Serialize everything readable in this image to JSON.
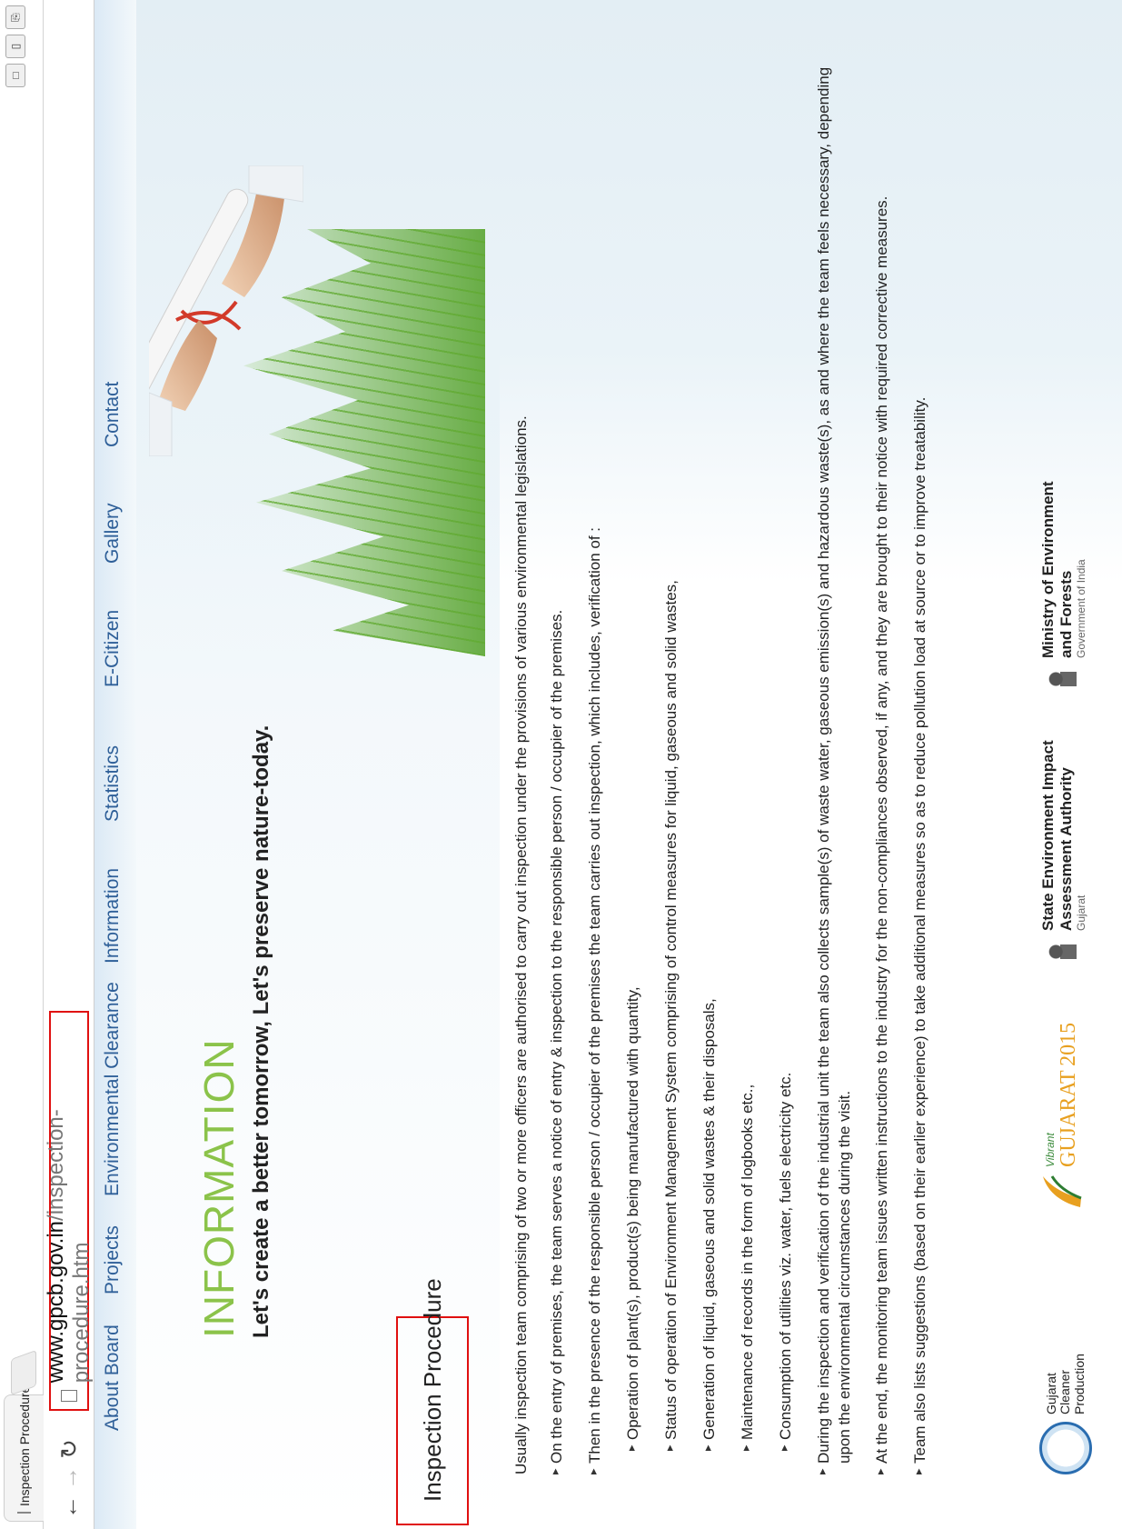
{
  "browser": {
    "tab_title": "Inspection Procedure",
    "tab_close": "×",
    "url_domain": "www.gpcb.gov.in",
    "url_path": "/inspection-procedure.htm",
    "window_controls": [
      "□",
      "▯",
      "⎘"
    ]
  },
  "nav": {
    "items": [
      "About Board",
      "Projects",
      "Environmental Clearance",
      "Information",
      "Statistics",
      "E-Citizen",
      "Gallery",
      "Contact"
    ]
  },
  "hero": {
    "heading": "INFORMATION",
    "tagline": "Let's create a better tomorrow, Let's preserve nature-today."
  },
  "section": {
    "title": "Inspection Procedure"
  },
  "content": {
    "intro": "Usually inspection team comprising of two or more officers are authorised to carry out inspection under the provisions of various environmental legislations.",
    "items": [
      "On the entry of premises, the team serves a notice of entry & inspection to the responsible person / occupier of the premises.",
      "Then in the presence of the responsible person / occupier of the premises the team carries out inspection, which includes, verification of :"
    ],
    "sub_items": [
      "Operation of plant(s), product(s) being manufactured with quantity,",
      "Status of operation of Environment Management System comprising of control measures for liquid, gaseous and solid wastes,",
      "Generation of liquid, gaseous and solid wastes & their disposals,",
      "Maintenance of records in the form of logbooks etc.,",
      "Consumption of utilities viz. water, fuels electricity etc."
    ],
    "items_after": [
      "During the inspection and verification of the industrial unit the team also collects sample(s) of waste water, gaseous emission(s) and hazardous waste(s), as and where the team feels necessary, depending upon the environmental circumstances during the visit.",
      "At the end, the monitoring team issues written instructions to the industry for the non-compliances observed, if any, and they are brought to their notice with required corrective measures.",
      "Team also lists suggestions (based on their earlier experience) to take additional measures so as to reduce pollution load at source or to improve treatability."
    ]
  },
  "footer": {
    "gcp": [
      "Gujarat",
      "Cleaner",
      "Production"
    ],
    "vg_small": "Vibrant",
    "vg_main": "GUJARAT",
    "vg_year": "2015",
    "seiaa": [
      "State Environment Impact",
      "Assessment Authority"
    ],
    "seiaa_sub": "Gujarat",
    "moef": [
      "Ministry of Environment",
      "and Forests"
    ],
    "moef_sub": "Government of India"
  }
}
